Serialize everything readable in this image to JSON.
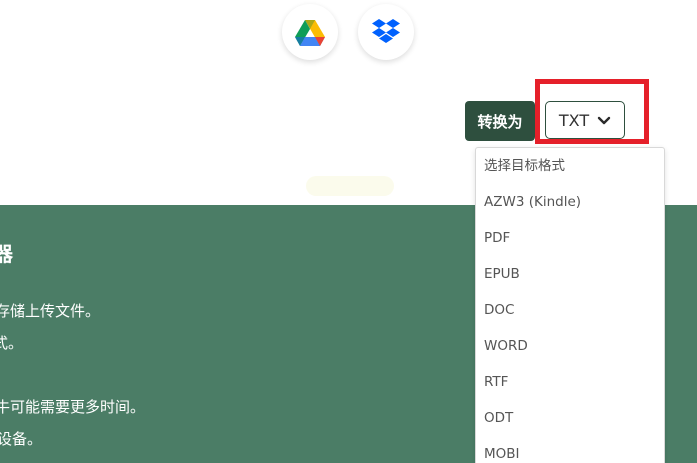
{
  "cloud": {
    "google_drive_icon": "google-drive-icon",
    "dropbox_icon": "dropbox-icon"
  },
  "convert": {
    "label": "转换为",
    "selected": "TXT",
    "chevron_icon": "chevron-down-icon"
  },
  "dropdown": {
    "options": [
      "选择目标格式",
      "AZW3 (Kindle)",
      "PDF",
      "EPUB",
      "DOC",
      "WORD",
      "RTF",
      "ODT",
      "MOBI"
    ]
  },
  "info": {
    "title": "器",
    "lines": [
      "存储上传文件。",
      "式。",
      "牛可能需要更多时间。",
      "设备。"
    ]
  },
  "colors": {
    "accent_dark": "#2e4f3e",
    "band_green": "#4b7d66",
    "highlight_red": "#e5202a"
  }
}
